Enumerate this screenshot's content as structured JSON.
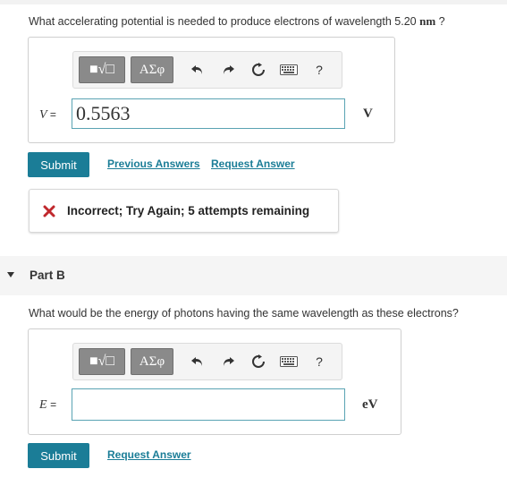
{
  "part_a": {
    "question": {
      "text": "What accelerating potential is needed to produce electrons of wavelength 5.20",
      "unit": "nm",
      "suffix": " ?"
    },
    "toolbar": {
      "template_label": "■√□",
      "greek_label": "ΑΣφ",
      "help_label": "?"
    },
    "variable": "V",
    "equals": "=",
    "input_value": "0.5563",
    "unit": "V",
    "submit_label": "Submit",
    "previous_answers_label": "Previous Answers",
    "request_answer_label": "Request Answer",
    "feedback": "Incorrect; Try Again; 5 attempts remaining"
  },
  "part_b": {
    "label": "Part B",
    "question": "What would be the energy of photons having the same wavelength as these electrons?",
    "toolbar": {
      "template_label": "■√□",
      "greek_label": "ΑΣφ",
      "help_label": "?"
    },
    "variable": "E",
    "equals": "=",
    "input_value": "",
    "unit": "eV",
    "submit_label": "Submit",
    "request_answer_label": "Request Answer"
  },
  "colors": {
    "accent": "#1b7d97",
    "error": "#c0282d",
    "input_border": "#5aa3b3"
  }
}
